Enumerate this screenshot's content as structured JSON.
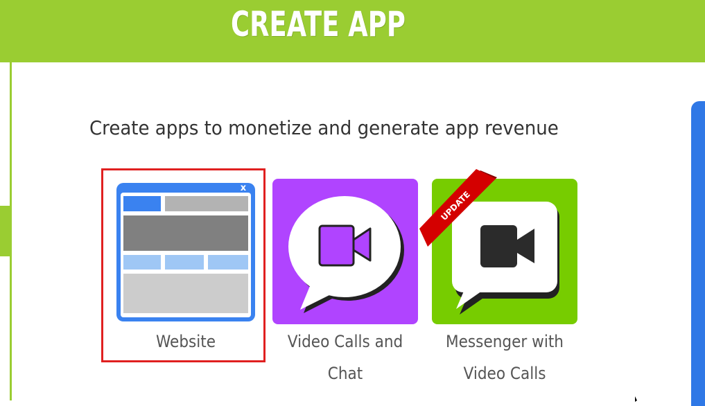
{
  "header": {
    "title": "CREATE APP"
  },
  "subtitle": "Create apps to monetize and generate app revenue",
  "apps": [
    {
      "label": "Website",
      "icon": "website-layout-icon",
      "selected": true
    },
    {
      "label_lines": [
        "Video Calls and",
        "Chat"
      ],
      "icon": "video-chat-bubble-icon"
    },
    {
      "label_lines": [
        "Messenger with",
        "Video Calls"
      ],
      "icon": "video-messenger-icon",
      "ribbon": "UPDATE"
    }
  ],
  "website_icon": {
    "close_glyph": "x"
  },
  "colors": {
    "header": "#9acd32",
    "selection_border": "#e02020",
    "video_chat_tile": "#b044ff",
    "messenger_tile": "#77cc00",
    "ribbon": "#d40000",
    "side_panel": "#2f78e6"
  }
}
